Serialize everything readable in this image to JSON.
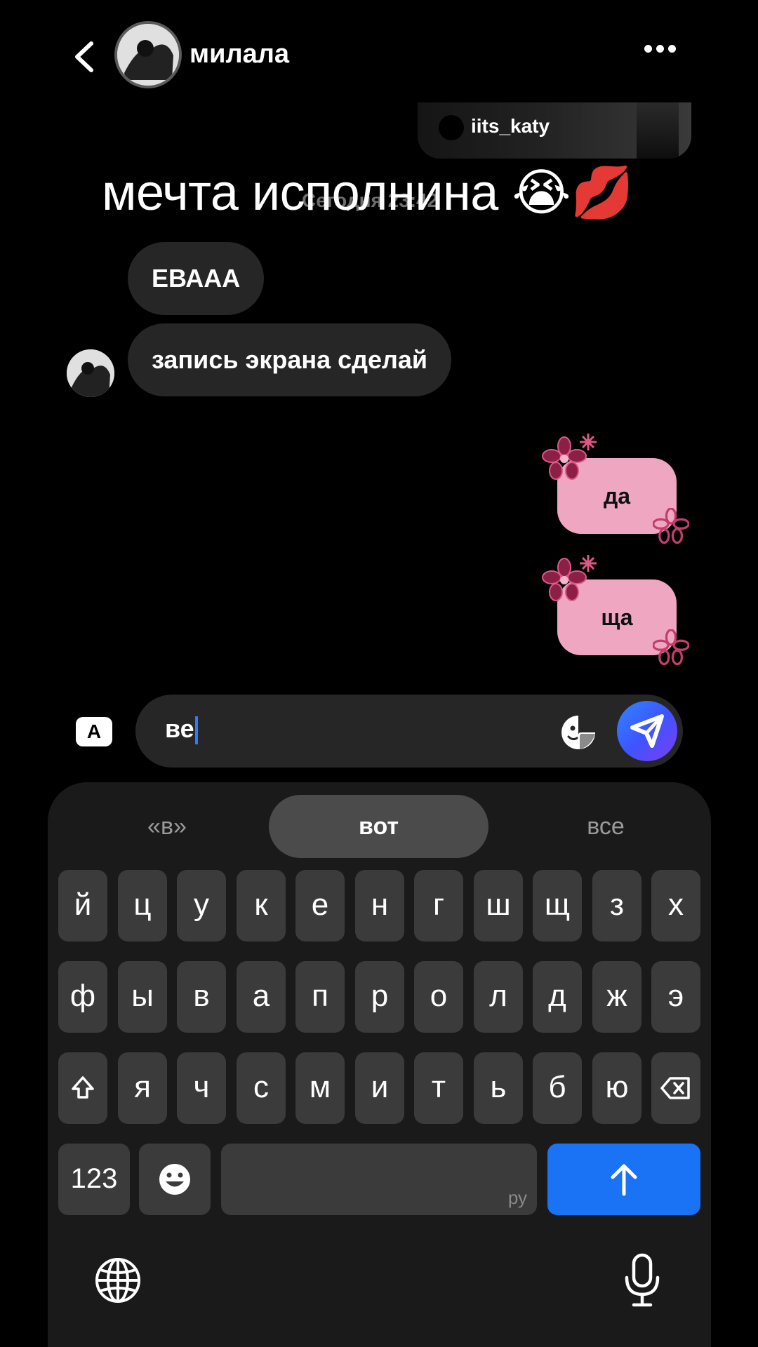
{
  "header": {
    "title": "милала"
  },
  "shared_reel": {
    "username": "iits_katy"
  },
  "overlay_caption": "мечта исполнина 😭💋",
  "timestamp": "Сегодня 23:42",
  "messages": [
    {
      "direction": "in",
      "text": "ЕВААА"
    },
    {
      "direction": "in",
      "text": "запись экрана сделай"
    },
    {
      "direction": "out",
      "text": "да"
    },
    {
      "direction": "out",
      "text": "ща"
    }
  ],
  "composer": {
    "value": "ве",
    "keyboard_switch_label": "A"
  },
  "keyboard": {
    "suggestions": [
      "«в»",
      "вот",
      "все"
    ],
    "rows": [
      [
        "й",
        "ц",
        "у",
        "к",
        "е",
        "н",
        "г",
        "ш",
        "щ",
        "з",
        "х"
      ],
      [
        "ф",
        "ы",
        "в",
        "а",
        "п",
        "р",
        "о",
        "л",
        "д",
        "ж",
        "э"
      ],
      [
        "я",
        "ч",
        "с",
        "м",
        "и",
        "т",
        "ь",
        "б",
        "ю"
      ]
    ],
    "numbers_label": "123",
    "space_lang": "ру"
  },
  "colors": {
    "incoming_bubble": "#262626",
    "outgoing_bubble": "#efa7c1",
    "return_key": "#1a73f5"
  }
}
